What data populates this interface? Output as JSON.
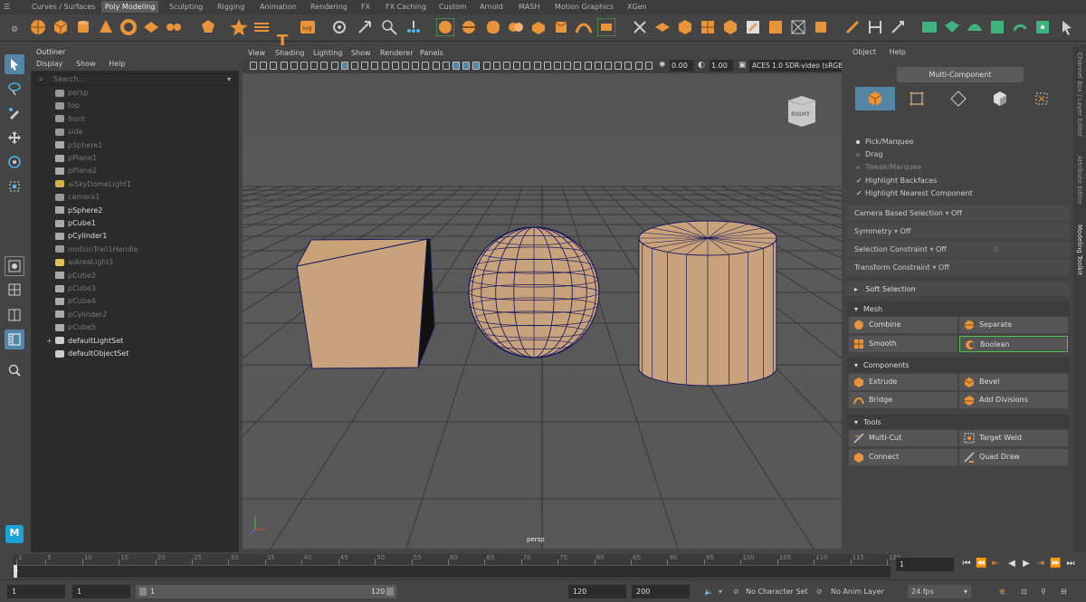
{
  "shelf_tabs": [
    {
      "label": "Curves / Surfaces",
      "active": false
    },
    {
      "label": "Poly Modeling",
      "active": true
    },
    {
      "label": "Sculpting",
      "active": false
    },
    {
      "label": "Rigging",
      "active": false
    },
    {
      "label": "Animation",
      "active": false
    },
    {
      "label": "Rendering",
      "active": false
    },
    {
      "label": "FX",
      "active": false
    },
    {
      "label": "FX Caching",
      "active": false
    },
    {
      "label": "Custom",
      "active": false
    },
    {
      "label": "Arnold",
      "active": false
    },
    {
      "label": "MASH",
      "active": false
    },
    {
      "label": "Motion Graphics",
      "active": false
    },
    {
      "label": "XGen",
      "active": false
    }
  ],
  "shelf_icons": [
    "sphere-icon",
    "cube-icon",
    "cylinder-icon",
    "cone-icon",
    "torus-icon",
    "plane-icon",
    "disc-icon",
    "platonic-icon",
    "sweep-icon",
    "superellipse-icon",
    "text-icon",
    "svg-icon",
    "sphere-poly-icon",
    "star-icon",
    "pipe-icon",
    "type-icon",
    "svg-import-icon",
    "gear-icon",
    "transform-icon",
    "vertex-icon",
    "soft-select-icon",
    "combine-icon",
    "separate-icon",
    "smooth-icon",
    "boolean-icon",
    "extrude-icon",
    "bevel-icon",
    "bridge-icon",
    "fill-hole-icon",
    "multicut-icon",
    "target-weld-icon",
    "connect-icon",
    "quad-draw-icon",
    "mirror-icon",
    "uv-icon",
    "unfold-icon",
    "layout-icon",
    "hide-icon",
    "history-icon",
    "freeze-icon",
    "center-icon",
    "snap-icon",
    "lasso-icon",
    "pivot-icon",
    "pointer-icon"
  ],
  "toolbox": {
    "tools": [
      "select-tool-icon",
      "lasso-tool-icon",
      "paint-select-icon",
      "move-tool-icon",
      "rotate-tool-icon",
      "scale-tool-icon"
    ],
    "layouts": [
      "single-pane-layout-icon",
      "four-pane-layout-icon",
      "two-pane-layout-icon",
      "outliner-layout-icon"
    ],
    "search_icon": "magnifier-icon",
    "logo_text": "M"
  },
  "outliner": {
    "title": "Outliner",
    "menus": [
      "Display",
      "Show",
      "Help"
    ],
    "search_placeholder": "Search...",
    "items": [
      {
        "label": "persp",
        "icon": "camera-icon",
        "dim": true
      },
      {
        "label": "top",
        "icon": "camera-icon",
        "dim": true
      },
      {
        "label": "front",
        "icon": "camera-icon",
        "dim": true
      },
      {
        "label": "side",
        "icon": "camera-icon",
        "dim": true
      },
      {
        "label": "pSphere1",
        "icon": "mesh-icon",
        "dim": true
      },
      {
        "label": "pPlane1",
        "icon": "mesh-icon",
        "dim": true
      },
      {
        "label": "pPlane2",
        "icon": "mesh-icon",
        "dim": true
      },
      {
        "label": "aiSkyDomeLight1",
        "icon": "skydome-icon",
        "dim": true
      },
      {
        "label": "camera1",
        "icon": "camera-icon",
        "dim": true
      },
      {
        "label": "pSphere2",
        "icon": "mesh-icon",
        "dim": false
      },
      {
        "label": "pCube1",
        "icon": "mesh-icon",
        "dim": false
      },
      {
        "label": "pCylinder1",
        "icon": "mesh-icon",
        "dim": false
      },
      {
        "label": "motionTrail1Handle",
        "icon": "motion-trail-icon",
        "dim": true
      },
      {
        "label": "aiAreaLight1",
        "icon": "area-light-icon",
        "dim": true
      },
      {
        "label": "pCube2",
        "icon": "mesh-icon",
        "dim": true
      },
      {
        "label": "pCube3",
        "icon": "mesh-icon",
        "dim": true
      },
      {
        "label": "pCube4",
        "icon": "mesh-icon",
        "dim": true
      },
      {
        "label": "pCylinder2",
        "icon": "mesh-icon",
        "dim": true
      },
      {
        "label": "pCube5",
        "icon": "mesh-icon",
        "dim": true
      },
      {
        "label": "defaultLightSet",
        "icon": "set-icon",
        "dim": false,
        "expand": "+"
      },
      {
        "label": "defaultObjectSet",
        "icon": "set-icon",
        "dim": false
      }
    ]
  },
  "viewport": {
    "menus": [
      "View",
      "Shading",
      "Lighting",
      "Show",
      "Renderer",
      "Panels"
    ],
    "exposure": "0.00",
    "gamma": "1.00",
    "color_space": "ACES 1.0 SDR-video (sRGB",
    "view_cube_label": "RIGHT",
    "camera_label": "persp",
    "mesh_color": "#c8a27c",
    "wire_color": "#1a1a5e",
    "grid_color": "#3a3a3a"
  },
  "modeling_toolkit": {
    "menus": [
      "Object",
      "Help"
    ],
    "mode_label": "Multi-Component",
    "component_modes": [
      "object-mode-icon",
      "vertex-mode-icon",
      "edge-mode-icon",
      "face-mode-icon",
      "uv-mode-icon"
    ],
    "pick_options": [
      {
        "label": "Pick/Marquee",
        "selected": true
      },
      {
        "label": "Drag",
        "selected": false
      },
      {
        "label": "Tweak/Marquee",
        "selected": false,
        "disabled": true
      }
    ],
    "checkboxes": [
      {
        "label": "Highlight Backfaces",
        "checked": true
      },
      {
        "label": "Highlight Nearest Component",
        "checked": true
      }
    ],
    "properties": [
      {
        "label": "Camera Based Selection",
        "value": "Off"
      },
      {
        "label": "Symmetry",
        "value": "Off"
      },
      {
        "label": "Selection Constraint",
        "value": "Off",
        "extra": "0"
      },
      {
        "label": "Transform Constraint",
        "value": "Off"
      }
    ],
    "soft_selection": "Soft Selection",
    "mesh_section": {
      "title": "Mesh",
      "buttons": [
        {
          "label": "Combine",
          "icon": "combine-icon"
        },
        {
          "label": "Separate",
          "icon": "separate-icon"
        },
        {
          "label": "Smooth",
          "icon": "smooth-icon"
        },
        {
          "label": "Boolean",
          "icon": "boolean-icon",
          "highlight": true
        }
      ]
    },
    "components_section": {
      "title": "Components",
      "buttons": [
        {
          "label": "Extrude",
          "icon": "extrude-icon"
        },
        {
          "label": "Bevel",
          "icon": "bevel-icon"
        },
        {
          "label": "Bridge",
          "icon": "bridge-icon"
        },
        {
          "label": "Add Divisions",
          "icon": "add-divisions-icon"
        }
      ]
    },
    "tools_section": {
      "title": "Tools",
      "buttons": [
        {
          "label": "Multi-Cut",
          "icon": "multicut-icon"
        },
        {
          "label": "Target Weld",
          "icon": "target-weld-icon"
        },
        {
          "label": "Connect",
          "icon": "connect-icon"
        },
        {
          "label": "Quad Draw",
          "icon": "quad-draw-icon"
        }
      ]
    }
  },
  "side_tabs": [
    {
      "label": "Channel Box / Layer Editor",
      "active": false
    },
    {
      "label": "Attribute Editor",
      "active": false
    },
    {
      "label": "Modeling Toolkit",
      "active": true
    }
  ],
  "timeline": {
    "ticks": [
      "1",
      "5",
      "10",
      "15",
      "20",
      "25",
      "30",
      "35",
      "40",
      "45",
      "50",
      "55",
      "60",
      "65",
      "70",
      "75",
      "80",
      "85",
      "90",
      "95",
      "100",
      "105",
      "110",
      "115",
      "120"
    ],
    "current_frame": "1",
    "playback_icons": [
      "go-to-start-icon",
      "step-back-key-icon",
      "step-back-frame-icon",
      "play-back-icon",
      "play-forward-icon",
      "step-forward-frame-icon",
      "step-forward-key-icon",
      "go-to-end-icon"
    ]
  },
  "range": {
    "start": "1",
    "anim_start": "1",
    "range_start": "1",
    "range_end": "120",
    "anim_end": "120",
    "end": "200",
    "character_set": "No Character Set",
    "anim_layer": "No Anim Layer",
    "fps": "24 fps"
  }
}
